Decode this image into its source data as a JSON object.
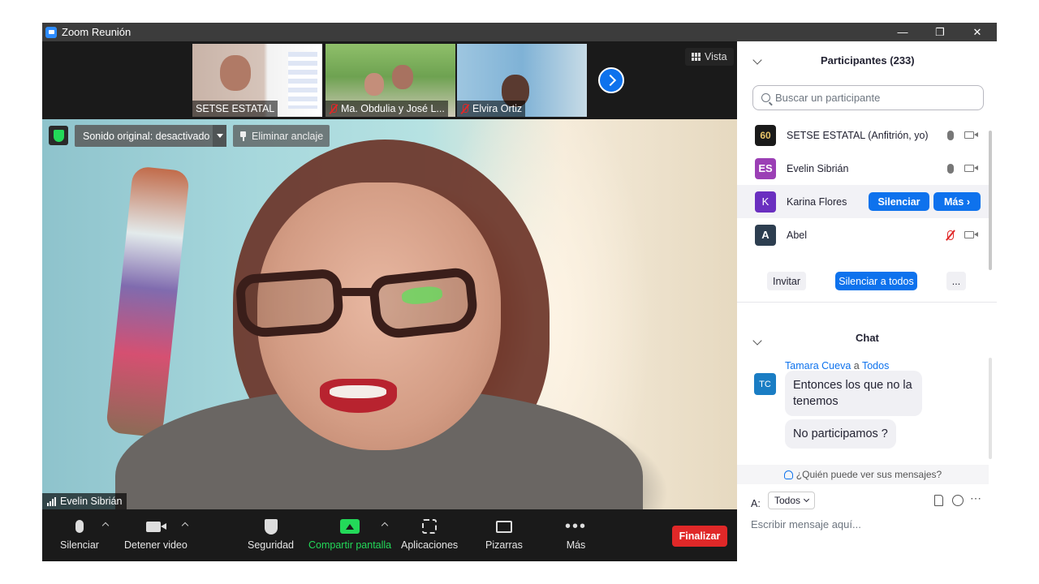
{
  "window": {
    "title": "Zoom Reunión"
  },
  "thumbnails": [
    {
      "name": "SETSE ESTATAL",
      "muted": false
    },
    {
      "name": "Ma. Obdulia y José L...",
      "muted": true
    },
    {
      "name": "Elvira Ortiz",
      "muted": true
    }
  ],
  "video": {
    "view_label": "Vista",
    "sound_label": "Sonido original: desactivado",
    "unpin_label": "Eliminar anclaje",
    "active_speaker": "Evelin Sibrián"
  },
  "toolbar": {
    "mute": "Silenciar",
    "stop_video": "Detener video",
    "security": "Seguridad",
    "share": "Compartir pantalla",
    "apps": "Aplicaciones",
    "whiteboards": "Pizarras",
    "more": "Más",
    "end": "Finalizar"
  },
  "participants": {
    "title": "Participantes (233)",
    "search_placeholder": "Buscar un participante",
    "list": [
      {
        "initials": "60",
        "name": "SETSE ESTATAL (Anfitrión, yo)",
        "color": "#1a1a1a",
        "mic": "on",
        "cam": "off"
      },
      {
        "initials": "ES",
        "name": "Evelin Sibrián",
        "color": "#9b3fb5",
        "mic": "on",
        "cam": "off"
      },
      {
        "initials": "K",
        "name": "Karina Flores",
        "color": "#6a2fc0",
        "mic": "",
        "cam": ""
      },
      {
        "initials": "A",
        "name": "Abel",
        "color": "#2d3e50",
        "mic": "off",
        "cam": "off"
      }
    ],
    "row_actions": {
      "mute": "Silenciar",
      "more": "Más"
    },
    "invite": "Invitar",
    "mute_all": "Silenciar a todos",
    "more": "..."
  },
  "chat": {
    "title": "Chat",
    "sender": "Tamara Cueva",
    "connector": "a",
    "recipient": "Todos",
    "sender_initials": "TC",
    "messages": [
      "Entonces los que no la tenemos",
      "No participamos ?"
    ],
    "who_can_see": "¿Quién puede ver sus mensajes?",
    "to_label": "A:",
    "to_value": "Todos",
    "input_placeholder": "Escribir mensaje aquí..."
  },
  "colors": {
    "accent": "#0e72ed",
    "end_red": "#e02828",
    "share_green": "#23d959"
  }
}
